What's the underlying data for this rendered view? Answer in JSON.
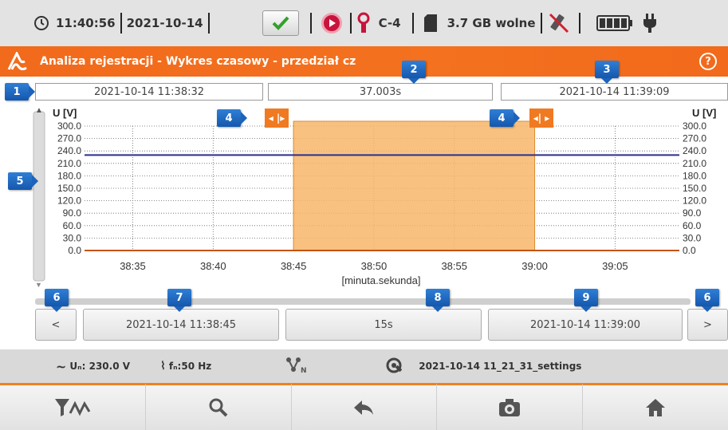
{
  "status": {
    "time": "11:40:56",
    "date": "2021-10-14",
    "clamp_label": "C-4",
    "storage": "3.7 GB wolne"
  },
  "title": "Analiza rejestracji - Wykres czasowy - przedział cz",
  "top_boxes": {
    "start": "2021-10-14 11:38:32",
    "span": "37.003s",
    "end": "2021-10-14 11:39:09"
  },
  "markers": {
    "m1": "1",
    "m2": "2",
    "m3": "3",
    "m4": "4",
    "m5": "5",
    "m6": "6",
    "m7": "7",
    "m8": "8",
    "m9": "9"
  },
  "chart_data": {
    "type": "line",
    "ylabel_left": "U [V]",
    "ylabel_right": "U [V]",
    "xlabel": "[minuta.sekunda]",
    "y_ticks": [
      "300.0",
      "270.0",
      "240.0",
      "210.0",
      "180.0",
      "150.0",
      "120.0",
      "90.0",
      "60.0",
      "30.0",
      "0.0"
    ],
    "ylim": [
      0,
      300
    ],
    "x_ticks": [
      "38:35",
      "38:40",
      "38:45",
      "38:50",
      "38:55",
      "39:00",
      "39:05"
    ],
    "x_tick_seconds": [
      35,
      40,
      45,
      50,
      55,
      60,
      65
    ],
    "xlim_seconds": [
      32,
      69
    ],
    "selection_seconds": [
      45,
      60
    ],
    "series": [
      {
        "color": "#2b2f8f",
        "x": [
          32,
          69
        ],
        "values": [
          230,
          230
        ]
      },
      {
        "color": "#c4530e",
        "x": [
          32,
          69
        ],
        "values": [
          0,
          0
        ]
      }
    ],
    "selection_color": "#f7b66a",
    "grid": true
  },
  "nav": {
    "prev": "<",
    "sel_start": "2021-10-14 11:38:45",
    "sel_span": "15s",
    "sel_end": "2021-10-14 11:39:00",
    "next": ">"
  },
  "info": {
    "un": "Uₙ: 230.0 V",
    "fn": "fₙ:50 Hz",
    "settings": "2021-10-14 11_21_31_settings"
  },
  "cursor_handles": {
    "left": "◂ |▸",
    "right": "◂| ▸"
  }
}
